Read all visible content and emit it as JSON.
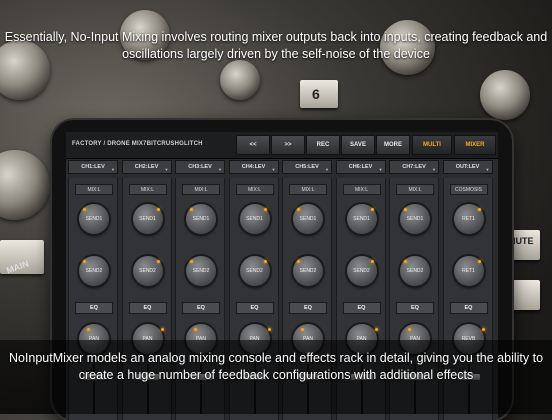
{
  "captions": {
    "top": "Essentially, No-Input Mixing involves routing mixer outputs back into inputs, creating feedback and oscillations largely driven by the self-noise of the device",
    "bottom": "NoInputMixer models an analog mixing console and effects rack in detail, giving you the ability to create a huge number of feedback configurations with additional effects"
  },
  "background_labels": {
    "num6": "6",
    "mute": "MUTE",
    "main": "MAIN"
  },
  "app": {
    "preset_name": "FACTORY / DRONE MIX7BITCRUSHGLITCH",
    "toolbar": {
      "prev": "<<",
      "next": ">>",
      "rec": "REC",
      "save": "SAVE",
      "more": "MORE",
      "multi": "MULTI",
      "mixer": "MIXER"
    },
    "accent": "#f5a623",
    "channels": [
      {
        "header": "CH1:LEV",
        "route": "MIX:L",
        "knob1": "SEND1",
        "knob2": "SEND2",
        "eq": "EQ",
        "knob3": "PAN"
      },
      {
        "header": "CH2:LEV",
        "route": "MIX:L",
        "knob1": "SEND1",
        "knob2": "SEND2",
        "eq": "EQ",
        "knob3": "PAN"
      },
      {
        "header": "CH3:LEV",
        "route": "MIX:L",
        "knob1": "SEND1",
        "knob2": "SEND2",
        "eq": "EQ",
        "knob3": "PAN"
      },
      {
        "header": "CH4:LEV",
        "route": "MIX:L",
        "knob1": "SEND1",
        "knob2": "SEND2",
        "eq": "EQ",
        "knob3": "PAN"
      },
      {
        "header": "CH5:LEV",
        "route": "MIX:L",
        "knob1": "SEND1",
        "knob2": "SEND2",
        "eq": "EQ",
        "knob3": "PAN"
      },
      {
        "header": "CH6:LEV",
        "route": "MIX:L",
        "knob1": "SEND1",
        "knob2": "SEND2",
        "eq": "EQ",
        "knob3": "PAN"
      },
      {
        "header": "CH7:LEV",
        "route": "MIX:L",
        "knob1": "SEND1",
        "knob2": "SEND2",
        "eq": "EQ",
        "knob3": "PAN"
      },
      {
        "header": "OUT:LEV",
        "route": "COSMOSIS",
        "knob1": "RET1",
        "knob2": "RET1",
        "eq": "EQ",
        "knob3": "REVB"
      }
    ]
  }
}
